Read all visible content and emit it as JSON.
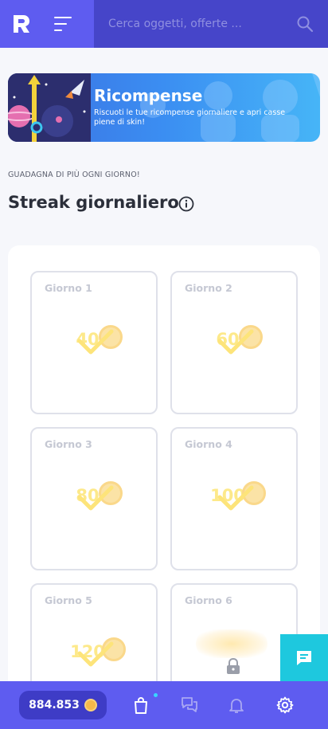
{
  "header": {
    "logo_letter": "R",
    "search_placeholder": "Cerca oggetti, offerte ..."
  },
  "banner": {
    "title": "Ricompense",
    "subtitle": "Riscuoti le tue ricompense giornaliere e apri casse piene di skin!"
  },
  "kicker": "GUADAGNA DI PIÙ OGNI GIORNO!",
  "section_title": "Streak giornaliero",
  "days": [
    {
      "label": "Giorno 1",
      "amount": "40",
      "state": "claimed"
    },
    {
      "label": "Giorno 2",
      "amount": "60",
      "state": "claimed"
    },
    {
      "label": "Giorno 3",
      "amount": "80",
      "state": "claimed"
    },
    {
      "label": "Giorno 4",
      "amount": "100",
      "state": "claimed"
    },
    {
      "label": "Giorno 5",
      "amount": "120",
      "state": "claimed"
    },
    {
      "label": "Giorno 6",
      "state": "locked"
    }
  ],
  "bottom_nav": {
    "balance": "884.853",
    "icons": [
      "shopping-bag-icon",
      "chat-bubbles-icon",
      "bell-icon",
      "gear-icon"
    ]
  },
  "colors": {
    "brand": "#5e5cf0",
    "brand_dark": "#4645c9",
    "accent": "#1ec8de",
    "coin": "#f6b94a",
    "reward_faded": "#fde98a"
  }
}
